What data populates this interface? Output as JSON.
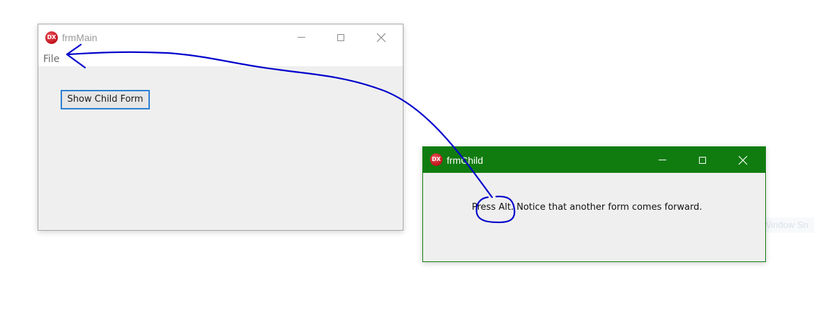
{
  "main_window": {
    "title": "frmMain",
    "logo_text": "DX",
    "menu": {
      "items": [
        {
          "label": "File"
        }
      ]
    },
    "show_child_button": "Show Child Form"
  },
  "child_window": {
    "title": "frmChild",
    "logo_text": "DX",
    "message": "Press Alt. Notice that another form comes forward.",
    "titlebar_color": "#107c10"
  },
  "background_ghost_text": "Window Sn",
  "annotation": {
    "color": "#0000cc",
    "description": "hand-drawn arrow from Alt in child message to File menu"
  },
  "icons": [
    "app-logo",
    "minimize-icon",
    "maximize-icon",
    "close-icon"
  ]
}
